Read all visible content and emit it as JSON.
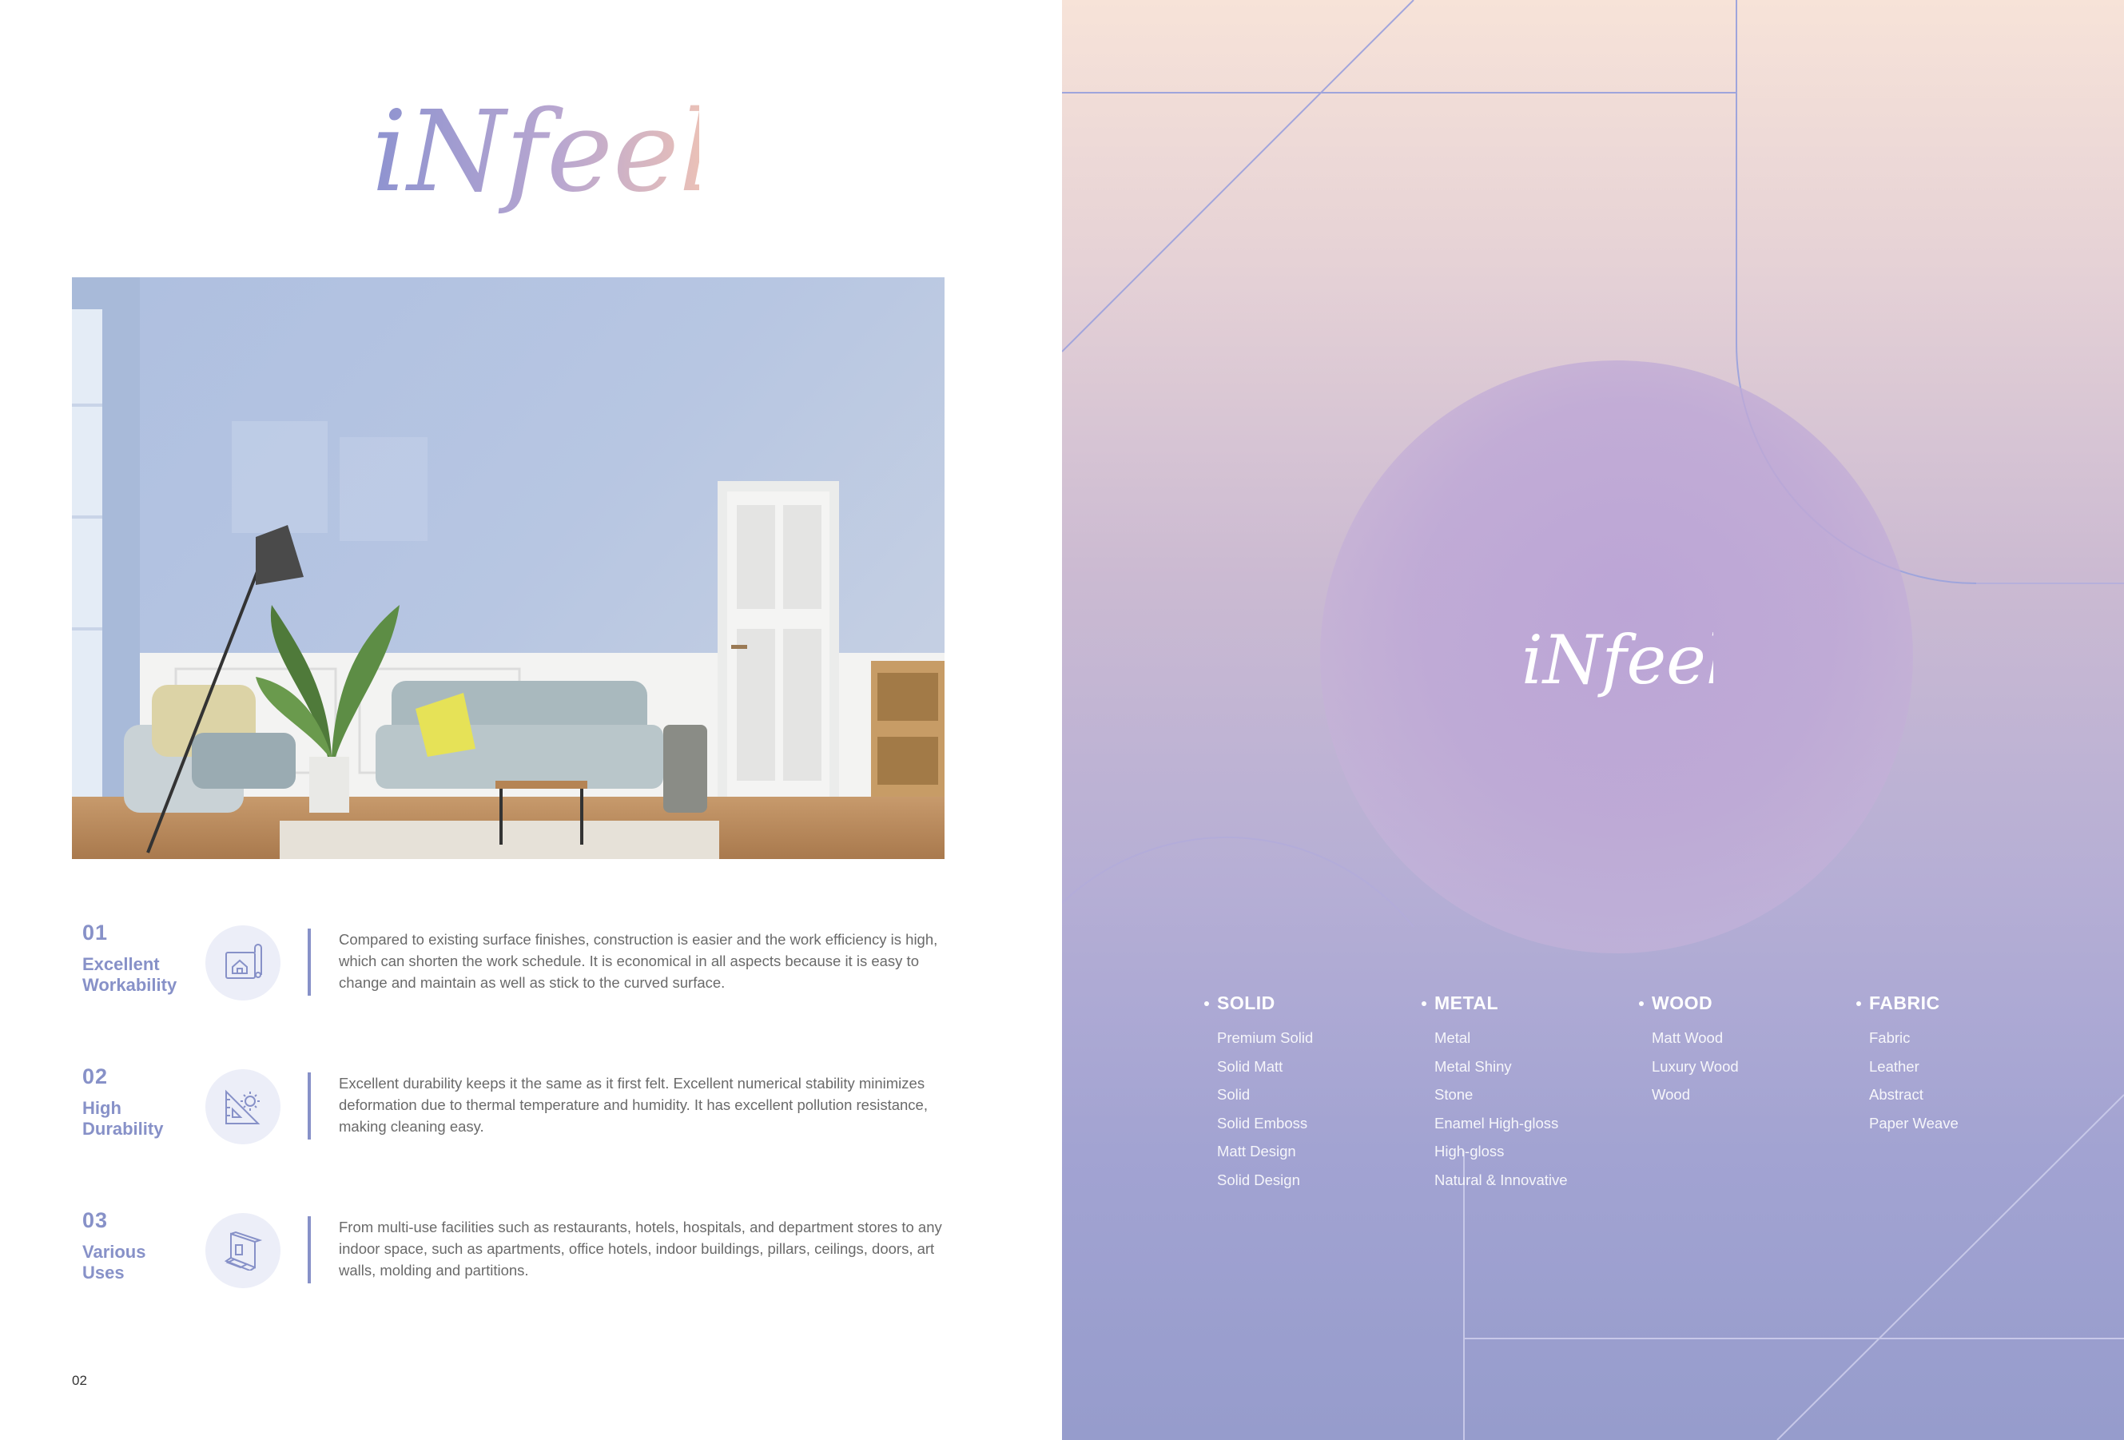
{
  "brand": {
    "logo_text": "iNfeel"
  },
  "photo": {
    "description_icon": "living-room-photo"
  },
  "features": [
    {
      "number": "01",
      "title_line1": "Excellent",
      "title_line2": "Workability",
      "icon": "blueprint-house-icon",
      "description": "Compared to existing surface finishes, construction is easier and the work efficiency is high, which can shorten the work schedule. It is economical in all aspects because it is easy to change and maintain as well as stick to the curved surface."
    },
    {
      "number": "02",
      "title_line1": "High",
      "title_line2": "Durability",
      "icon": "ruler-gear-icon",
      "description": "Excellent durability keeps it the same as it first felt. Excellent numerical stability minimizes deformation due to thermal temperature and humidity. It has excellent pollution resistance, making cleaning easy."
    },
    {
      "number": "03",
      "title_line1": "Various",
      "title_line2": "Uses",
      "icon": "room-box-icon",
      "description": "From multi-use facilities such as restaurants, hotels, hospitals, and department stores to any indoor space, such as apartments, office hotels, indoor buildings, pillars, ceilings, doors, art walls, molding and partitions."
    }
  ],
  "page_number": "02",
  "categories": [
    {
      "name": "SOLID",
      "items": [
        "Premium Solid",
        "Solid Matt",
        "Solid",
        "Solid Emboss",
        "Matt Design",
        "Solid Design"
      ]
    },
    {
      "name": "METAL",
      "items": [
        "Metal",
        "Metal Shiny",
        "Stone",
        "Enamel High-gloss",
        "High-gloss",
        "Natural & Innovative"
      ]
    },
    {
      "name": "WOOD",
      "items": [
        "Matt Wood",
        "Luxury Wood",
        "Wood"
      ]
    },
    {
      "name": "FABRIC",
      "items": [
        "Fabric",
        "Leather",
        "Abstract",
        "Paper Weave"
      ]
    }
  ],
  "colors": {
    "accent": "#8791c8",
    "text": "#6a6a6a",
    "gradient_top": "#f7e3d8",
    "gradient_bottom": "#969ccc"
  }
}
